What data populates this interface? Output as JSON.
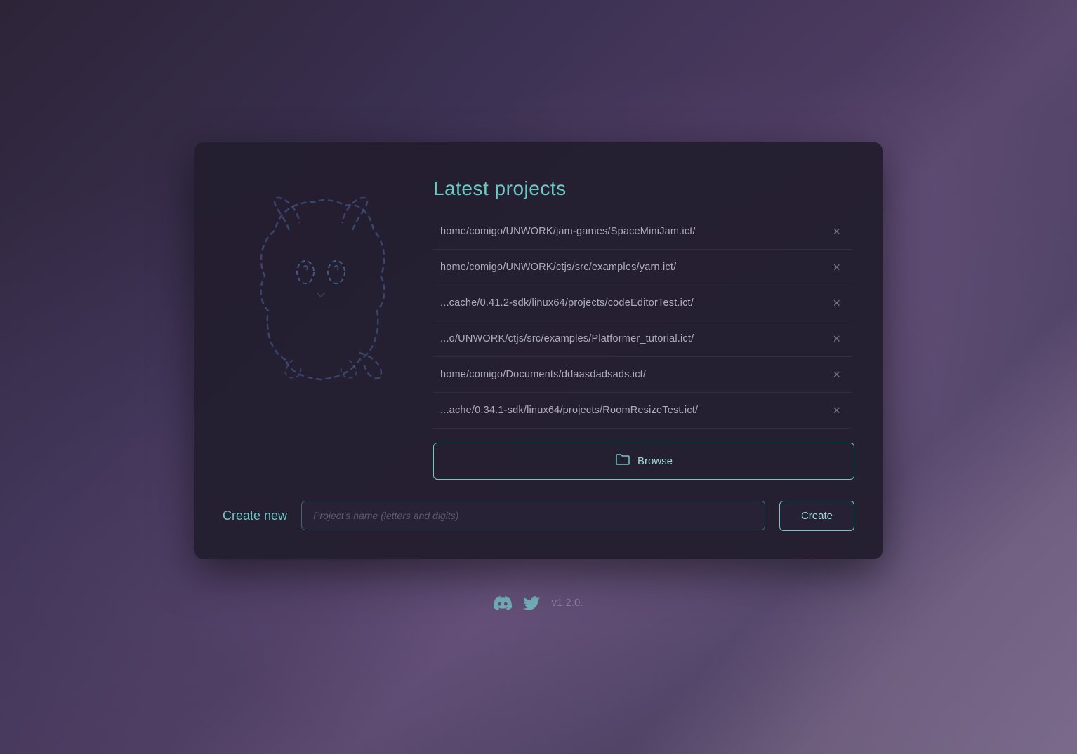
{
  "dialog": {
    "title": "Latest projects",
    "projects": [
      {
        "path": "home/comigo/UNWORK/jam-games/SpaceMiniJam.ict/"
      },
      {
        "path": "home/comigo/UNWORK/ctjs/src/examples/yarn.ict/"
      },
      {
        "path": "...cache/0.41.2-sdk/linux64/projects/codeEditorTest.ict/"
      },
      {
        "path": "...o/UNWORK/ctjs/src/examples/Platformer_tutorial.ict/"
      },
      {
        "path": "home/comigo/Documents/ddaasdadsads.ict/"
      },
      {
        "path": "...ache/0.34.1-sdk/linux64/projects/RoomResizeTest.ict/"
      }
    ],
    "browse_label": "Browse",
    "create_new_label": "Create new",
    "project_name_placeholder": "Project's name (letters and digits)",
    "create_button_label": "Create"
  },
  "footer": {
    "version": "v1.2.0."
  },
  "icons": {
    "close": "×",
    "folder": "📁",
    "discord": "discord-icon",
    "twitter": "twitter-icon"
  }
}
